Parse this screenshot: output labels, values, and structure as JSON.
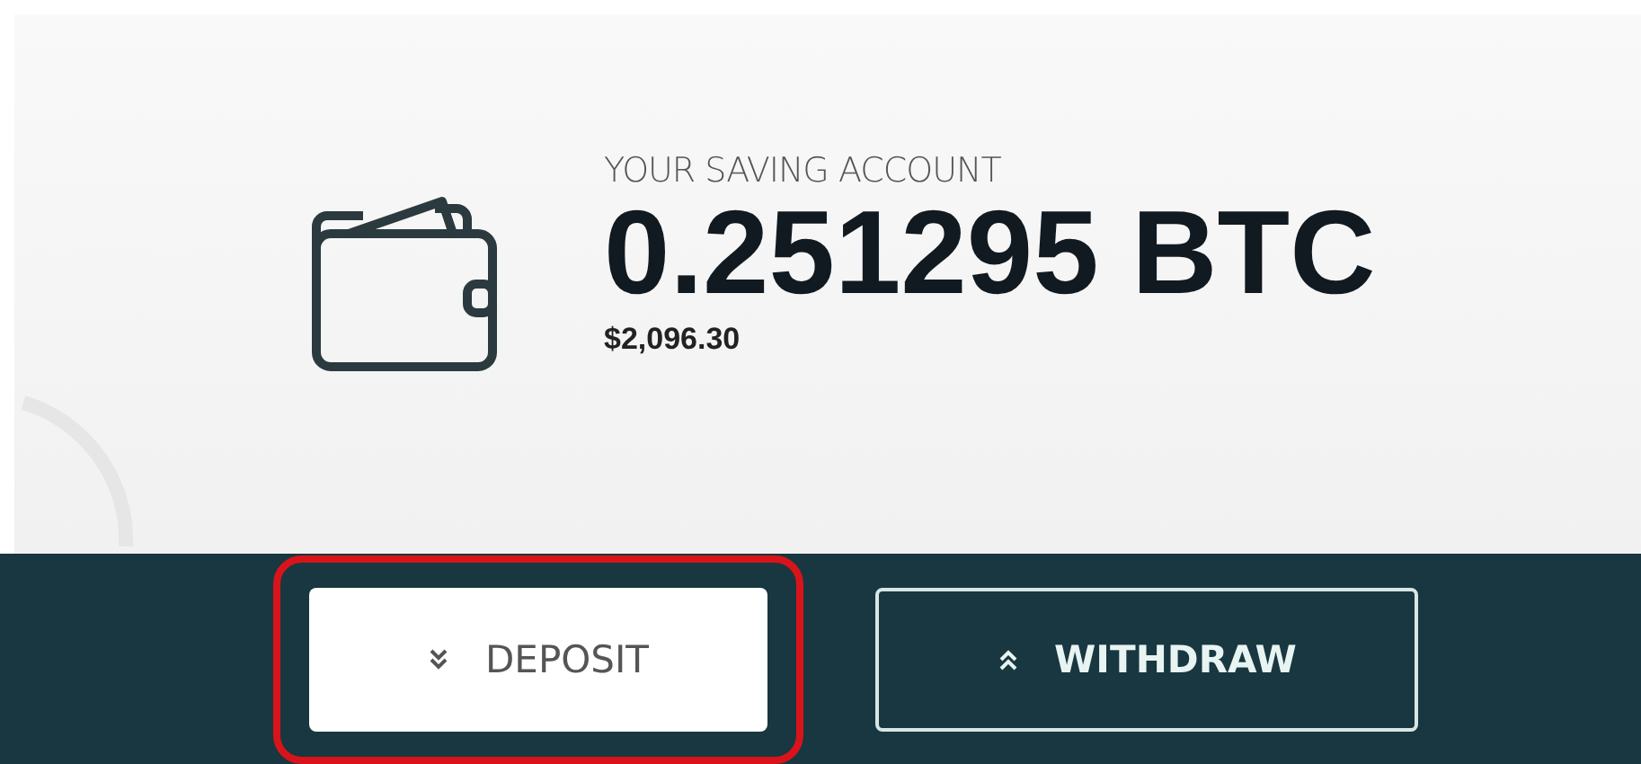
{
  "account": {
    "label": "YOUR SAVING ACCOUNT",
    "balance": "0.251295 BTC",
    "fiat_value": "$2,096.30"
  },
  "buttons": [
    {
      "label": "DEPOSIT",
      "kind": "filled",
      "highlighted": true
    },
    {
      "label": "WITHDRAW",
      "kind": "outline",
      "highlighted": false
    }
  ]
}
